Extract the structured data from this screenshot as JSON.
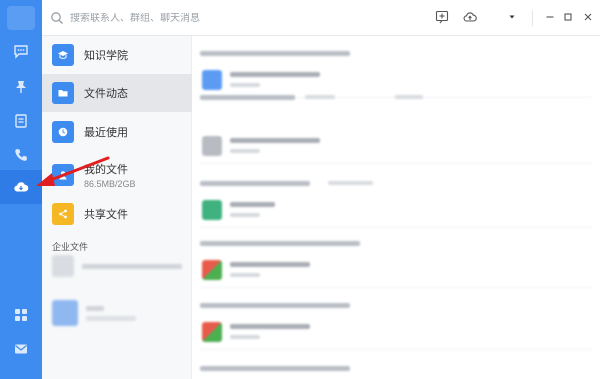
{
  "search": {
    "placeholder": "搜索联系人、群组、聊天消息"
  },
  "sidebar": {
    "items": [
      {
        "name": "chat-icon"
      },
      {
        "name": "pin-icon"
      },
      {
        "name": "contacts-icon"
      },
      {
        "name": "phone-icon"
      },
      {
        "name": "cloud-drive-icon"
      },
      {
        "name": "apps-grid-icon"
      },
      {
        "name": "mail-icon"
      }
    ]
  },
  "nav": {
    "items": [
      {
        "label": "知识学院",
        "sub": "",
        "color": "#3f8cf0"
      },
      {
        "label": "文件动态",
        "sub": "",
        "color": "#3f8cf0"
      },
      {
        "label": "最近使用",
        "sub": "",
        "color": "#3f8cf0"
      },
      {
        "label": "我的文件",
        "sub": "86.5MB/2GB",
        "color": "#3f8cf0"
      },
      {
        "label": "共享文件",
        "sub": "",
        "color": "#f5b723"
      }
    ],
    "section_title": "企业文件"
  },
  "colors": {
    "accent": "#3f8cf0",
    "share": "#f5b723",
    "arrow": "#e02020"
  }
}
